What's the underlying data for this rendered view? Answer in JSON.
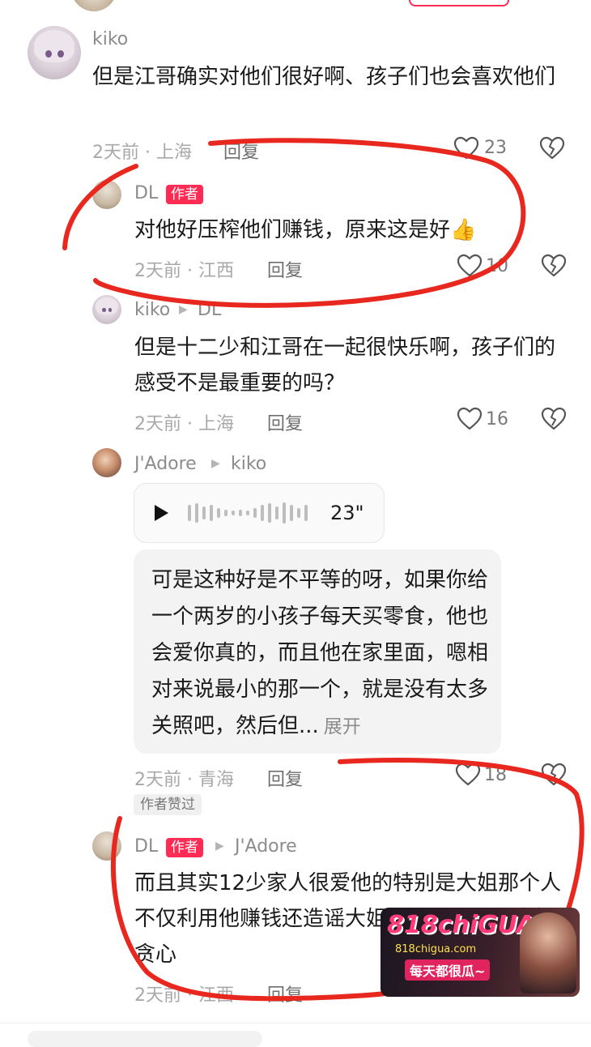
{
  "comments": [
    {
      "author": "kiko",
      "text": "但是江哥确实对他们很好啊、孩子们也会喜欢他们",
      "meta": "2天前 · 上海",
      "reply_label": "回复",
      "likes": "23"
    },
    {
      "author": "DL",
      "author_badge": "作者",
      "text": "对他好压榨他们赚钱，原来这是好👍",
      "meta": "2天前 · 江西",
      "reply_label": "回复",
      "likes": "10"
    },
    {
      "author": "kiko",
      "reply_to": "DL",
      "text": "但是十二少和江哥在一起很快乐啊，孩子们的感受不是最重要的吗？",
      "meta": "2天前 · 上海",
      "reply_label": "回复",
      "likes": "16"
    },
    {
      "author": "J'Adore",
      "reply_to": "kiko",
      "voice_duration": "23\"",
      "text": "可是这种好是不平等的呀，如果你给一个两岁的小孩子每天买零食，他也会爱你真的，而且他在家里面，嗯相对来说最小的那一个，就是没有太多关照吧，然后但...",
      "expand_label": "展开",
      "meta": "2天前 · 青海",
      "reply_label": "回复",
      "likes": "18",
      "liked_by_author_label": "作者赞过"
    },
    {
      "author": "DL",
      "author_badge": "作者",
      "reply_to": "J'Adore",
      "text": "而且其实12少家人很爱他的特别是大姐那个人不仅利用他赚钱还造谣大姐说，在谁都说大姐贪心",
      "meta": "2天前 · 江西",
      "reply_label": "回复",
      "likes": "2"
    }
  ],
  "watermark": {
    "brand": "818chiGUA",
    "site": "818chigua.com",
    "slogan": "每天都很瓜~"
  },
  "colors": {
    "author_badge": "#fe2c55",
    "annotation_red": "#e8281e"
  }
}
